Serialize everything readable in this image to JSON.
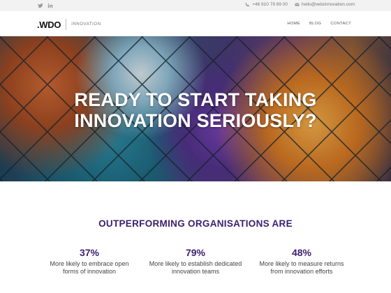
{
  "topbar": {
    "social_icons": [
      "twitter-icon",
      "linkedin-icon"
    ],
    "phone": "+46 910 79 89 00",
    "email": "hello@wdoinnovation.com"
  },
  "header": {
    "logo_mark": ".WDO",
    "logo_sub": "INNOVATION",
    "nav": [
      {
        "label": "HOME"
      },
      {
        "label": "BLOG"
      },
      {
        "label": "CONTACT"
      }
    ]
  },
  "hero": {
    "title_line1": "READY TO START TAKING",
    "title_line2": "INNOVATION SERIOUSLY?"
  },
  "stats_section": {
    "title": "OUTPERFORMING ORGANISATIONS ARE",
    "stats": [
      {
        "value": "37%",
        "line1": "More likely to embrace open",
        "line2": "forms of innovation"
      },
      {
        "value": "79%",
        "line1": "More likely to establish dedicated",
        "line2": "innovation teams"
      },
      {
        "value": "48%",
        "line1": "More likely to measure returns",
        "line2": "from innovation efforts"
      }
    ]
  },
  "colors": {
    "accent": "#3b1f6e",
    "topbar_bg": "#f2f2f2"
  }
}
